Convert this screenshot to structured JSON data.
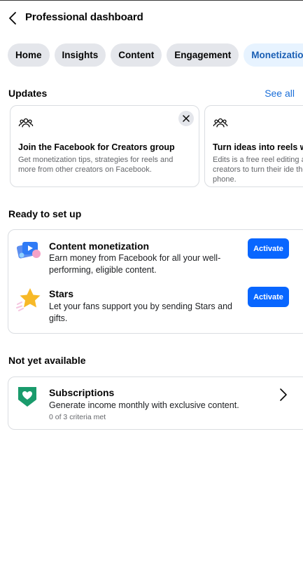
{
  "header": {
    "title": "Professional dashboard"
  },
  "tabs": [
    {
      "label": "Home",
      "active": false
    },
    {
      "label": "Insights",
      "active": false
    },
    {
      "label": "Content",
      "active": false
    },
    {
      "label": "Engagement",
      "active": false
    },
    {
      "label": "Monetization",
      "active": true
    }
  ],
  "updates": {
    "title": "Updates",
    "see_all": "See all",
    "cards": [
      {
        "title": "Join the Facebook for Creators group",
        "desc": "Get monetization tips, strategies for reels and more from other creators on Facebook."
      },
      {
        "title": "Turn ideas into reels wi",
        "desc": "Edits is a free reel editing a for creators to turn their ide their phone."
      }
    ]
  },
  "ready": {
    "title": "Ready to set up",
    "items": [
      {
        "title": "Content monetization",
        "desc": "Earn money from Facebook for all your well-performing, eligible content.",
        "button": "Activate"
      },
      {
        "title": "Stars",
        "desc": "Let your fans support you by sending Stars and gifts.",
        "button": "Activate"
      }
    ]
  },
  "not_available": {
    "title": "Not yet available",
    "item": {
      "title": "Subscriptions",
      "desc": "Generate income monthly with exclusive content.",
      "criteria": "0 of 3 criteria met"
    }
  },
  "colors": {
    "accent": "#0866ff",
    "link": "#1a6ed8",
    "active_tab_bg": "#e7f3ff",
    "subscriptions_icon": "#1a9b6c"
  },
  "icons": [
    "back-arrow-icon",
    "group-icon",
    "close-icon",
    "content-monetization-icon",
    "star-icon",
    "subscriptions-heart-icon",
    "chevron-right-icon"
  ]
}
